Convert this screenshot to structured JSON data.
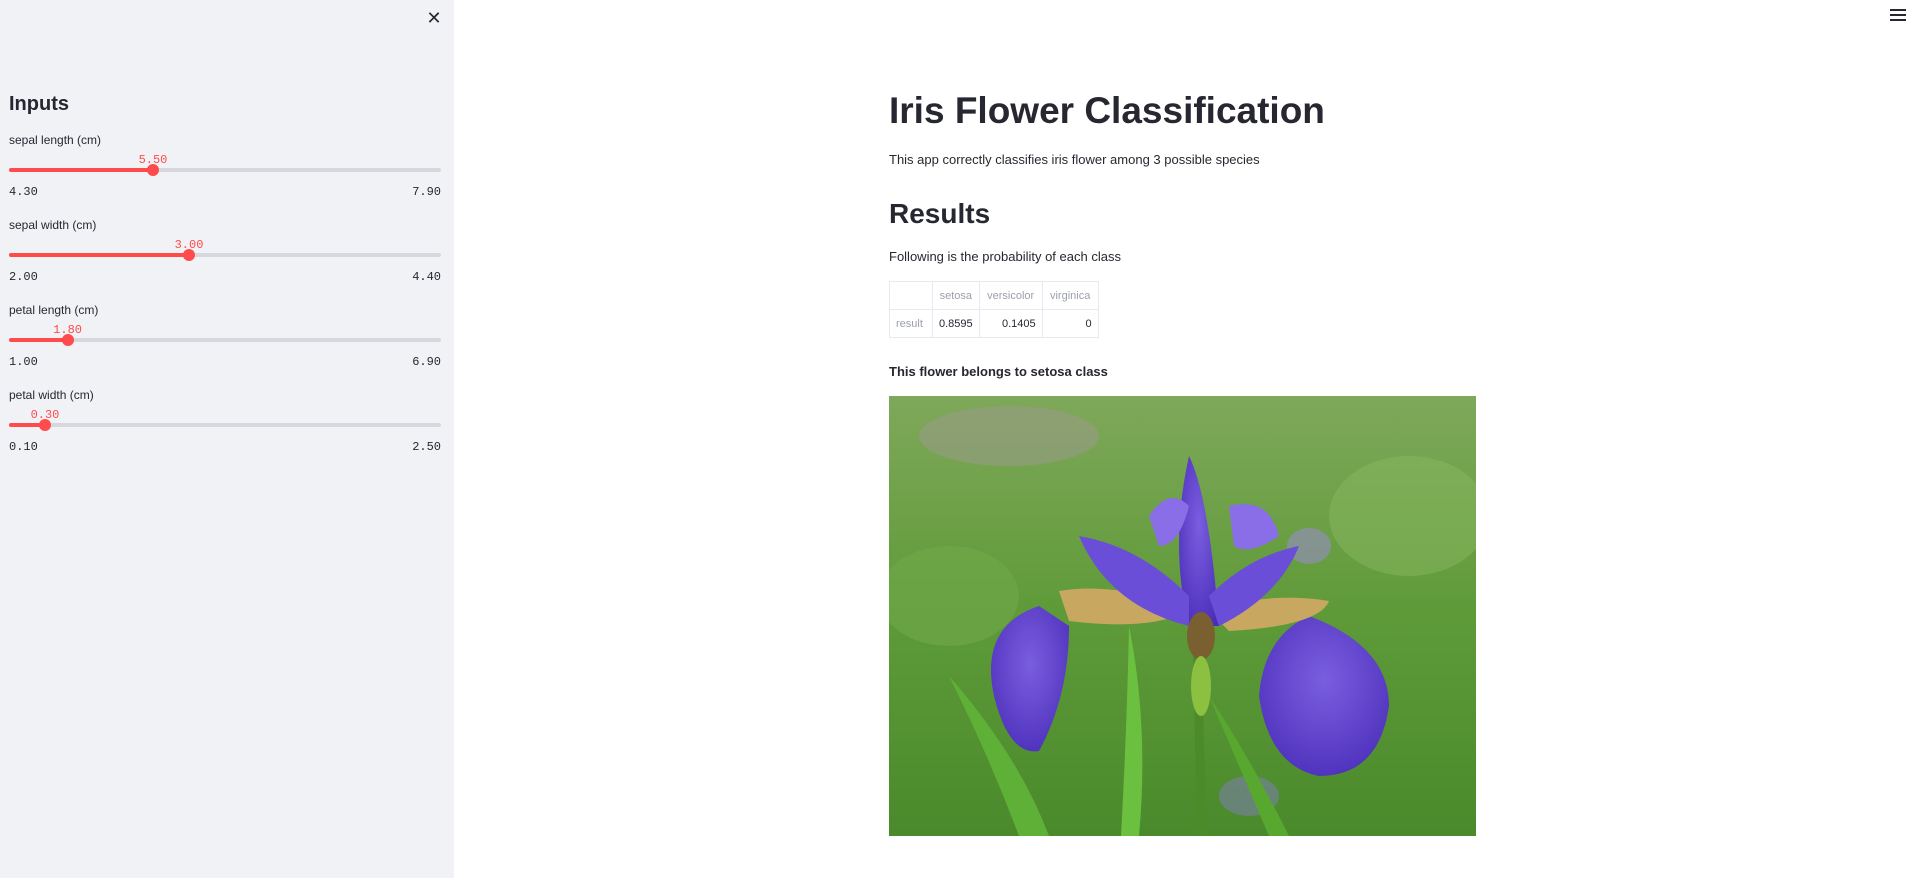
{
  "sidebar": {
    "title": "Inputs",
    "close_icon": "close-icon",
    "sliders": [
      {
        "label": "sepal length (cm)",
        "value": "5.50",
        "min": "4.30",
        "max": "7.90",
        "fraction": 0.3333
      },
      {
        "label": "sepal width (cm)",
        "value": "3.00",
        "min": "2.00",
        "max": "4.40",
        "fraction": 0.4167
      },
      {
        "label": "petal length (cm)",
        "value": "1.80",
        "min": "1.00",
        "max": "6.90",
        "fraction": 0.1356
      },
      {
        "label": "petal width (cm)",
        "value": "0.30",
        "min": "0.10",
        "max": "2.50",
        "fraction": 0.0833
      }
    ]
  },
  "header": {
    "menu_icon": "hamburger-menu-icon"
  },
  "main": {
    "title": "Iris Flower Classification",
    "description": "This app correctly classifies iris flower among 3 possible species",
    "results_heading": "Results",
    "results_description": "Following is the probability of each class",
    "table": {
      "columns": [
        "",
        "setosa",
        "versicolor",
        "virginica"
      ],
      "rows": [
        {
          "label": "result",
          "values": [
            "0.8595",
            "0.1405",
            "0"
          ]
        }
      ]
    },
    "verdict": "This flower belongs to setosa class"
  },
  "colors": {
    "accent": "#ff4b4b",
    "sidebar_bg": "#f0f2f6",
    "text": "#262730"
  }
}
